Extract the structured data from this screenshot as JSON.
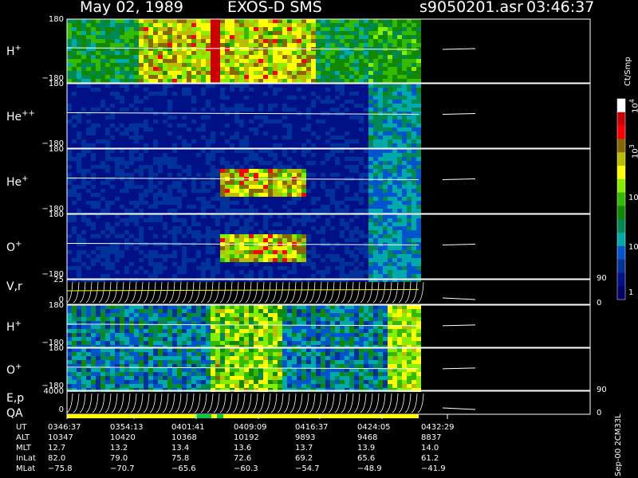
{
  "header": {
    "date": "May 02, 1989",
    "mission": "EXOS-D SMS",
    "file": "s9050201.asr",
    "time": "03:46:37"
  },
  "panels": [
    {
      "label": "H",
      "sup": "+",
      "top": "180",
      "bottom": "−180"
    },
    {
      "label": "He",
      "sup": "++",
      "top": "180",
      "bottom": "−180"
    },
    {
      "label": "He",
      "sup": "+",
      "top": "180",
      "bottom": "−180"
    },
    {
      "label": "O",
      "sup": "+",
      "top": "180",
      "bottom": "−180"
    },
    {
      "label": "V,r",
      "sup": "",
      "top": "25",
      "bottom": "0",
      "right_top": "90",
      "right_bottom": "0"
    },
    {
      "label": "H",
      "sup": "+",
      "top": "180",
      "bottom": "−180"
    },
    {
      "label": "O",
      "sup": "+",
      "top": "180",
      "bottom": "−180"
    },
    {
      "label": "E,p",
      "sup": "",
      "top": "4000",
      "bottom": "0",
      "right_top": "90",
      "right_bottom": "0"
    }
  ],
  "qa_label": "QA",
  "colorbar": {
    "unit": "Ct/Smp",
    "ticks": [
      "10^4",
      "10^3",
      "100",
      "10",
      "1"
    ],
    "colors": [
      "#ffffff",
      "#cc0000",
      "#ff0000",
      "#886600",
      "#bbbb00",
      "#ffff00",
      "#88ee00",
      "#33bb00",
      "#118800",
      "#008855",
      "#00aaaa",
      "#0055cc",
      "#003399",
      "#001188",
      "#000066"
    ]
  },
  "footer_label": "Sep-00 2CM33L",
  "table": {
    "rows": [
      {
        "name": "UT",
        "values": [
          "0346:37",
          "0354:13",
          "0401:41",
          "0409:09",
          "0416:37",
          "0424:05",
          "0432:29"
        ]
      },
      {
        "name": "ALT",
        "values": [
          "10347",
          "10420",
          "10368",
          "10192",
          "9893",
          "9468",
          "8837"
        ]
      },
      {
        "name": "MLT",
        "values": [
          "12.7",
          "13.2",
          "13.4",
          "13.6",
          "13.7",
          "13.9",
          "14.0"
        ]
      },
      {
        "name": "InLat",
        "values": [
          "82.0",
          "79.0",
          "75.8",
          "72.6",
          "69.2",
          "65.6",
          "61.2"
        ]
      },
      {
        "name": "MLat",
        "values": [
          "−75.8",
          "−70.7",
          "−65.6",
          "−60.3",
          "−54.7",
          "−48.9",
          "−41.9"
        ]
      }
    ]
  },
  "chart_data": {
    "type": "heatmap",
    "x_tick_labels": [
      "0346:37",
      "0354:13",
      "0401:41",
      "0409:09",
      "0416:37",
      "0424:05",
      "0432:29"
    ],
    "panel_series": [
      {
        "name": "H+",
        "ylim": [
          -180,
          180
        ]
      },
      {
        "name": "He++",
        "ylim": [
          -180,
          180
        ]
      },
      {
        "name": "He+",
        "ylim": [
          -180,
          180
        ]
      },
      {
        "name": "O+",
        "ylim": [
          -180,
          180
        ]
      },
      {
        "name": "V,r",
        "ylim": [
          0,
          25
        ]
      },
      {
        "name": "H+",
        "ylim": [
          -180,
          180
        ]
      },
      {
        "name": "O+",
        "ylim": [
          -180,
          180
        ]
      },
      {
        "name": "E,p",
        "ylim": [
          0,
          4000
        ]
      }
    ],
    "colorbar_range": [
      1,
      10000
    ],
    "colorbar_unit": "Ct/Smp",
    "data_coverage_end_tick": "0424:05"
  }
}
